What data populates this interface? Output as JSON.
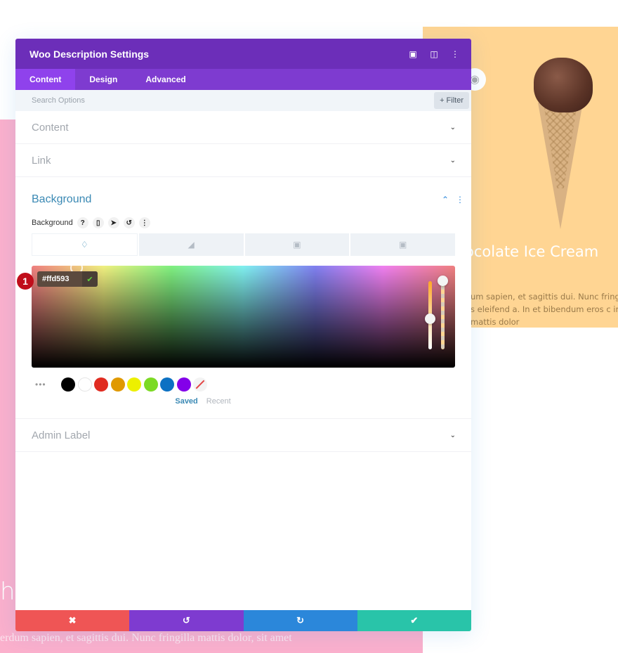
{
  "page": {
    "pink_heading_fragment": "h",
    "pink_text_line1": "erdum sapien, et sagittis dui. Nunc fringilla mattis dolor, sit amet",
    "pink_text_line2": "",
    "yellow_title": "ocolate Ice Cream",
    "yellow_text_lines": [
      "um sapien, et sagittis dui. Nunc fringilla ma",
      "s eleifend a. In et bibendum eros c interdu",
      "mattis dolor"
    ],
    "colors": {
      "pink": "#fbb0cc",
      "yellow": "#ffd593"
    }
  },
  "modal": {
    "title": "Woo Description Settings",
    "header_icons": [
      "expand-icon",
      "split-view-icon",
      "more-options-icon"
    ],
    "tabs": [
      {
        "label": "Content",
        "active": true
      },
      {
        "label": "Design",
        "active": false
      },
      {
        "label": "Advanced",
        "active": false
      }
    ],
    "search": {
      "placeholder": "Search Options",
      "value": ""
    },
    "filter_label": "+ Filter",
    "sections": [
      {
        "label": "Content",
        "expanded": false
      },
      {
        "label": "Link",
        "expanded": false
      },
      {
        "label": "Background",
        "expanded": true
      },
      {
        "label": "Admin Label",
        "expanded": false
      }
    ],
    "background": {
      "label": "Background",
      "label_icons": [
        "help-icon",
        "mobile-icon",
        "pointer-icon",
        "reset-icon",
        "more-icon"
      ],
      "type_tabs": [
        "color",
        "gradient",
        "image",
        "video"
      ],
      "active_type": "color",
      "hex_value": "#ffd593",
      "marker_number": "1",
      "swatches": [
        "#000000",
        "#ffffff",
        "#e02b20",
        "#e09900",
        "#edf000",
        "#7cda24",
        "#0c71c3",
        "#8300e9"
      ],
      "palette_tabs": [
        {
          "label": "Saved",
          "active": true
        },
        {
          "label": "Recent",
          "active": false
        }
      ]
    },
    "footer": {
      "cancel": "✖",
      "undo": "↺",
      "redo": "↻",
      "save": "✔"
    },
    "colors": {
      "header": "#6c2eb9",
      "tabs": "#7e3bd0",
      "active_tab": "#8f42ec",
      "cancel": "#ef5555",
      "undo": "#7e3bd0",
      "redo": "#2b87da",
      "save": "#29c4a9"
    }
  }
}
